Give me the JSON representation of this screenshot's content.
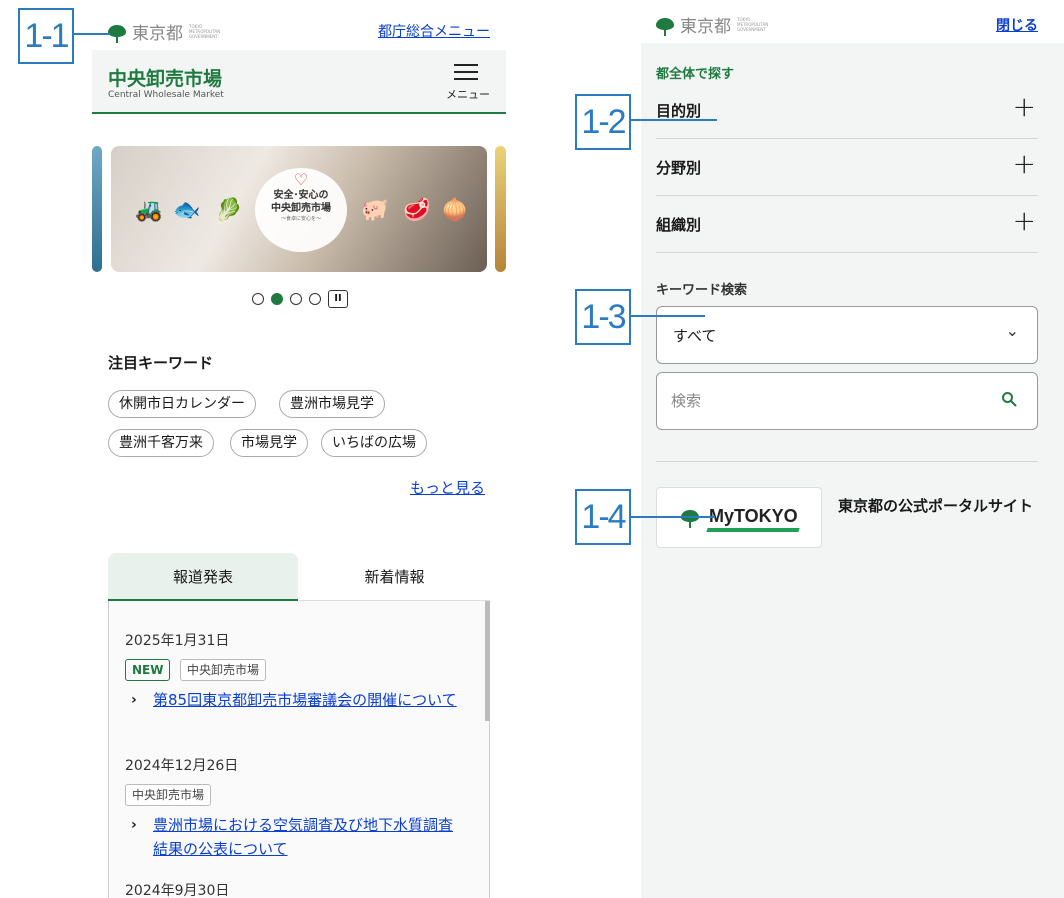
{
  "callouts": {
    "c1": "1-1",
    "c2": "1-2",
    "c3": "1-3",
    "c4": "1-4"
  },
  "left": {
    "logo_text": "東京都",
    "logo_small": "TOKYO METROPOLITAN GOVERNMENT",
    "top_link": "都庁総合メニュー",
    "site_title": "中央卸売市場",
    "site_subtitle": "Central Wholesale Market",
    "menu_label": "メニュー",
    "banner": {
      "line1": "安全･安心の",
      "line2": "中央卸売市場",
      "line3": "〜食卓に安心を〜"
    },
    "pause_label": "II",
    "keywords_title": "注目キーワード",
    "keywords": [
      "休開市日カレンダー",
      "豊洲市場見学",
      "豊洲千客万来",
      "市場見学",
      "いちばの広場"
    ],
    "more_link": "もっと見る",
    "tabs": [
      {
        "label": "報道発表",
        "active": true
      },
      {
        "label": "新着情報",
        "active": false
      }
    ],
    "news": [
      {
        "date": "2025年1月31日",
        "new_badge": "NEW",
        "category": "中央卸売市場",
        "title": "第85回東京都卸売市場審議会の開催について"
      },
      {
        "date": "2024年12月26日",
        "category": "中央卸売市場",
        "title": "豊洲市場における空気調査及び地下水質調査結果の公表について"
      },
      {
        "date": "2024年9月30日"
      }
    ]
  },
  "right": {
    "logo_text": "東京都",
    "close_link": "閉じる",
    "section_title": "都全体で探す",
    "rows": [
      "目的別",
      "分野別",
      "組織別"
    ],
    "keyword_label": "キーワード検索",
    "select_value": "すべて",
    "search_placeholder": "検索",
    "mytokyo_logo": "MyTOKYO",
    "portal_text": "東京都の公式ポータルサイト"
  },
  "colors": {
    "brand_green": "#1f7a3f",
    "link_blue": "#0b3fd0",
    "callout_blue": "#2a7bbf"
  }
}
